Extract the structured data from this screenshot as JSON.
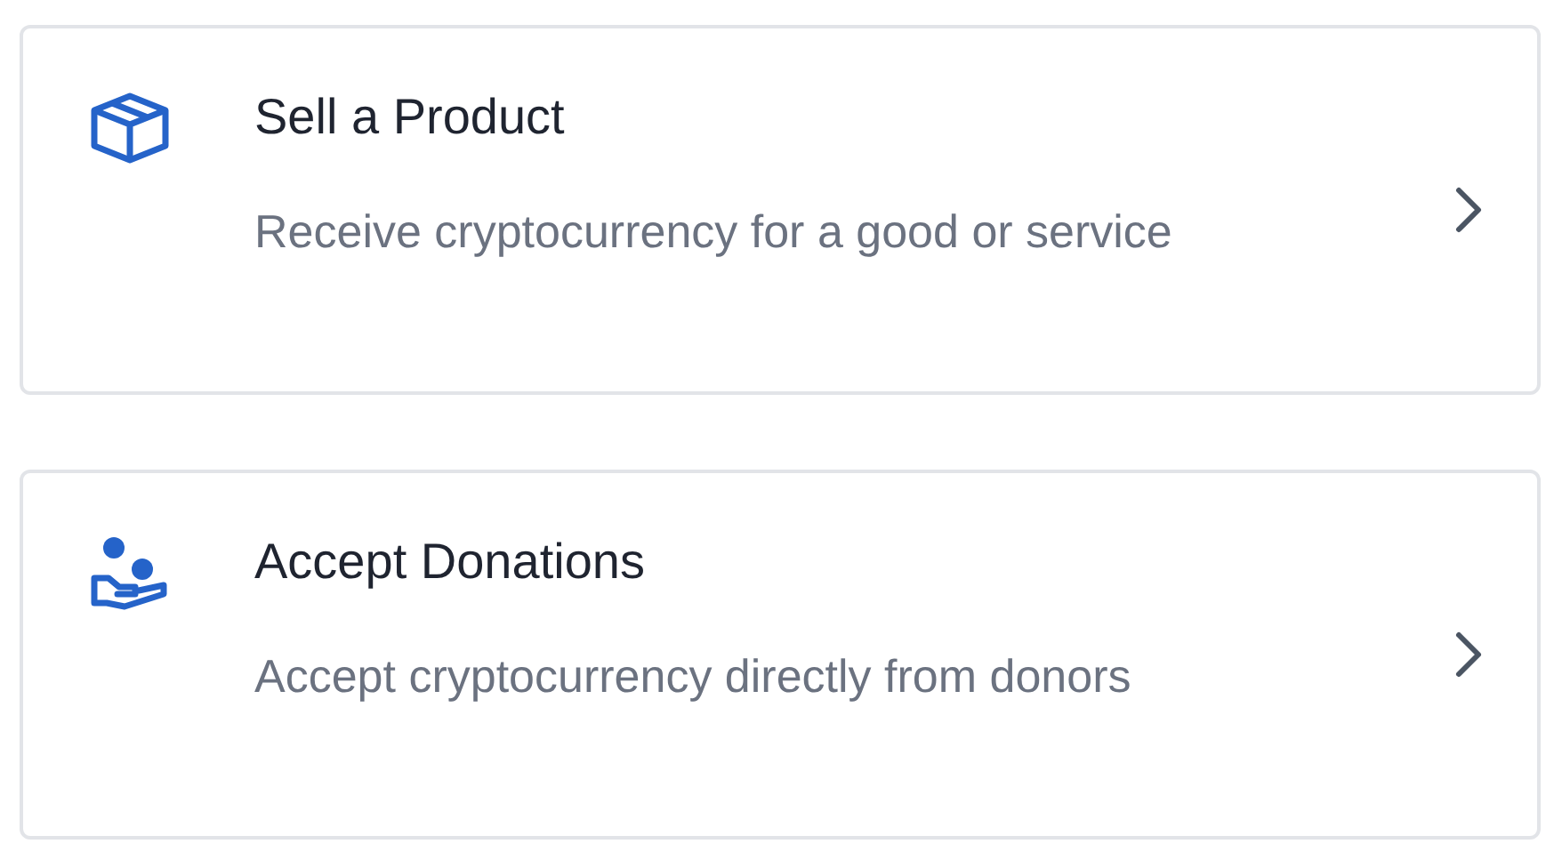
{
  "options": [
    {
      "kind": "product",
      "title": "Sell a Product",
      "description": "Receive cryptocurrency for a good or service"
    },
    {
      "kind": "donation",
      "title": "Accept Donations",
      "description": "Accept cryptocurrency directly from donors"
    }
  ]
}
